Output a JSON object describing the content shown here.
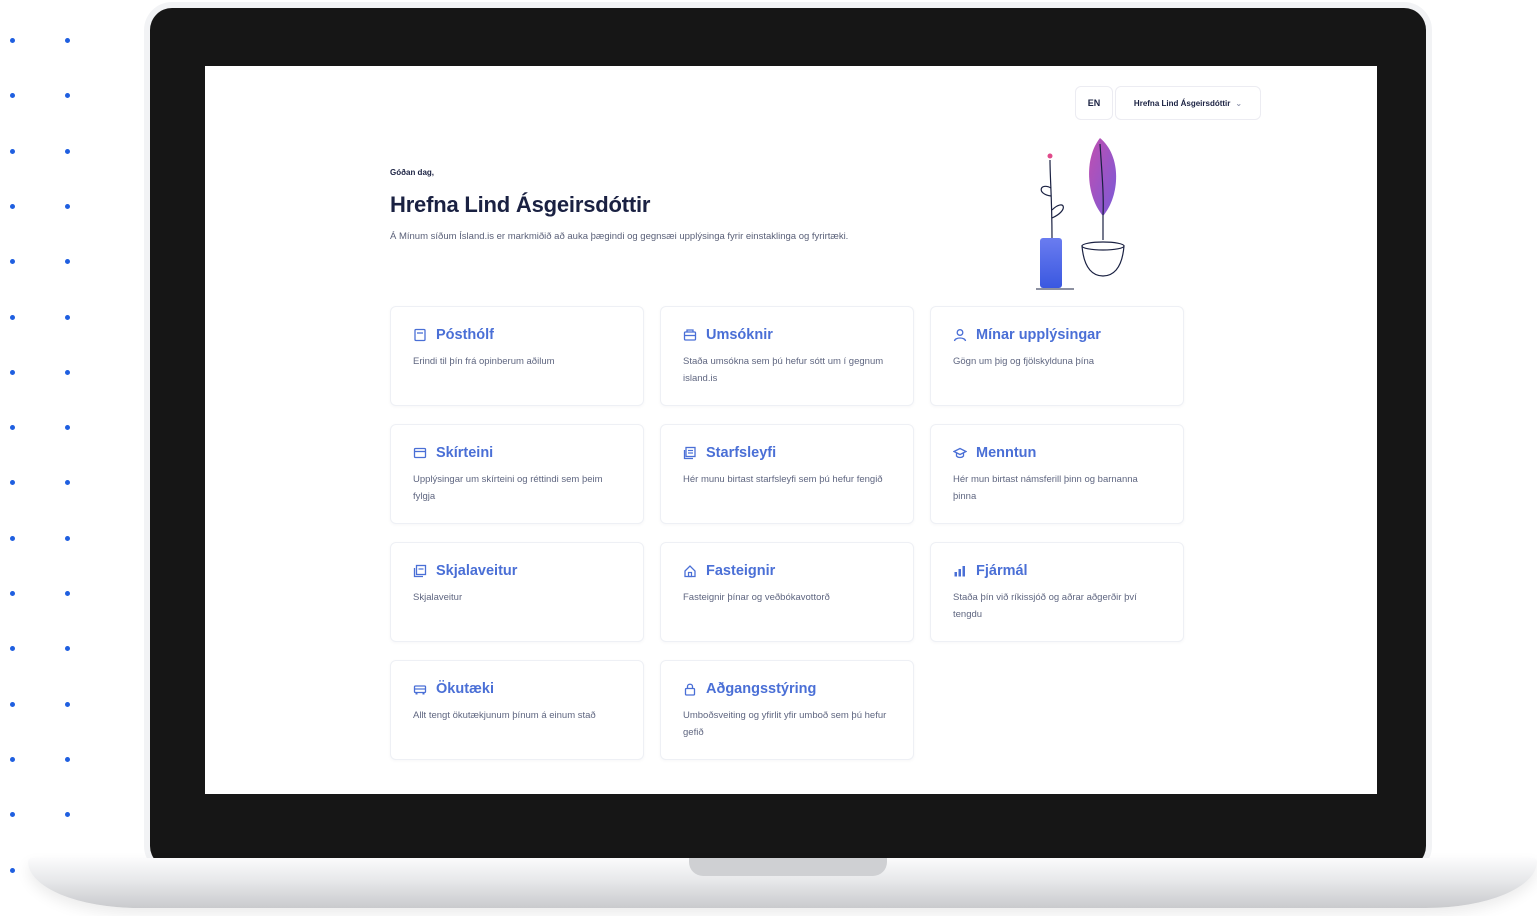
{
  "header": {
    "language_label": "EN",
    "user_name": "Hrefna Lind Ásgeirsdóttir",
    "dropdown_icon": "chevron-down-icon"
  },
  "greeting": {
    "small_text": "Góðan dag,",
    "name": "Hrefna Lind Ásgeirsdóttir",
    "description": "Á Mínum síðum Ísland.is er markmiðið að auka þægindi og gegnsæi upplýsinga fyrir einstaklinga og fyrirtæki."
  },
  "colors": {
    "accent": "#4a6fd6",
    "heading": "#1a2142",
    "dots": "#1f5fe0"
  },
  "cards": [
    {
      "title": "Pósthólf",
      "desc": "Erindi til þín frá opinberum aðilum",
      "icon": "mailbox-icon"
    },
    {
      "title": "Umsóknir",
      "desc": "Staða umsókna sem þú hefur sótt um í gegnum island.is",
      "icon": "applications-icon"
    },
    {
      "title": "Mínar upplýsingar",
      "desc": "Gögn um þig og fjölskylduna þína",
      "icon": "user-icon"
    },
    {
      "title": "Skírteini",
      "desc": "Upplýsingar um skírteini og réttindi sem þeim fylgja",
      "icon": "id-card-icon"
    },
    {
      "title": "Starfsleyfi",
      "desc": "Hér munu birtast starfsleyfi sem þú hefur fengið",
      "icon": "license-icon"
    },
    {
      "title": "Menntun",
      "desc": "Hér mun birtast námsferill þinn og barnanna þinna",
      "icon": "graduation-cap-icon"
    },
    {
      "title": "Skjalaveitur",
      "desc": "Skjalaveitur",
      "icon": "document-provider-icon"
    },
    {
      "title": "Fasteignir",
      "desc": "Fasteignir þínar og veðbókavottorð",
      "icon": "house-icon"
    },
    {
      "title": "Fjármál",
      "desc": "Staða þín við ríkissjóð og aðrar aðgerðir því tengdu",
      "icon": "bar-chart-icon"
    },
    {
      "title": "Ökutæki",
      "desc": "Allt tengt ökutækjunum þínum á einum stað",
      "icon": "car-icon"
    },
    {
      "title": "Aðgangsstýring",
      "desc": "Umboðsveiting og yfirlit yfir umboð sem þú hefur gefið",
      "icon": "lock-icon"
    }
  ]
}
